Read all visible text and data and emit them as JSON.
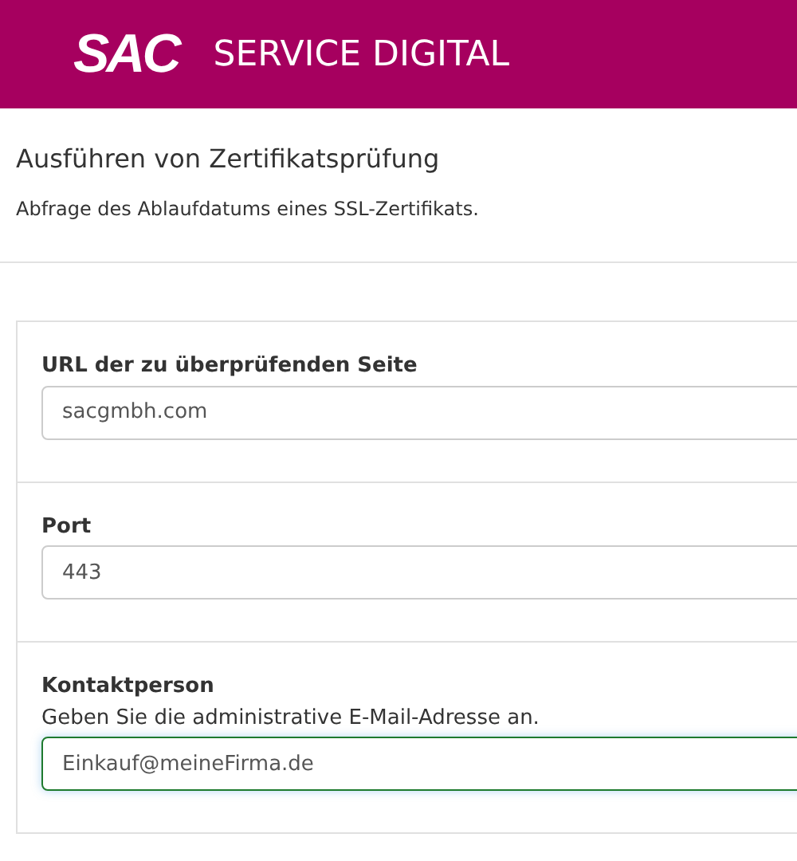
{
  "header": {
    "logo": "SAC",
    "title": "SERVICE DIGITAL"
  },
  "page": {
    "title": "Ausführen von Zertifikatsprüfung",
    "subtitle": "Abfrage des Ablaufdatums eines SSL-Zertifikats."
  },
  "fields": [
    {
      "label": "URL der zu überprüfenden Seite",
      "value": "sacgmbh.com",
      "focused": false
    },
    {
      "label": "Port",
      "value": "443",
      "focused": false
    },
    {
      "label": "Kontaktperson",
      "description": "Geben Sie die administrative E-Mail-Adresse an.",
      "value": "Einkauf@meineFirma.de",
      "focused": true
    }
  ]
}
